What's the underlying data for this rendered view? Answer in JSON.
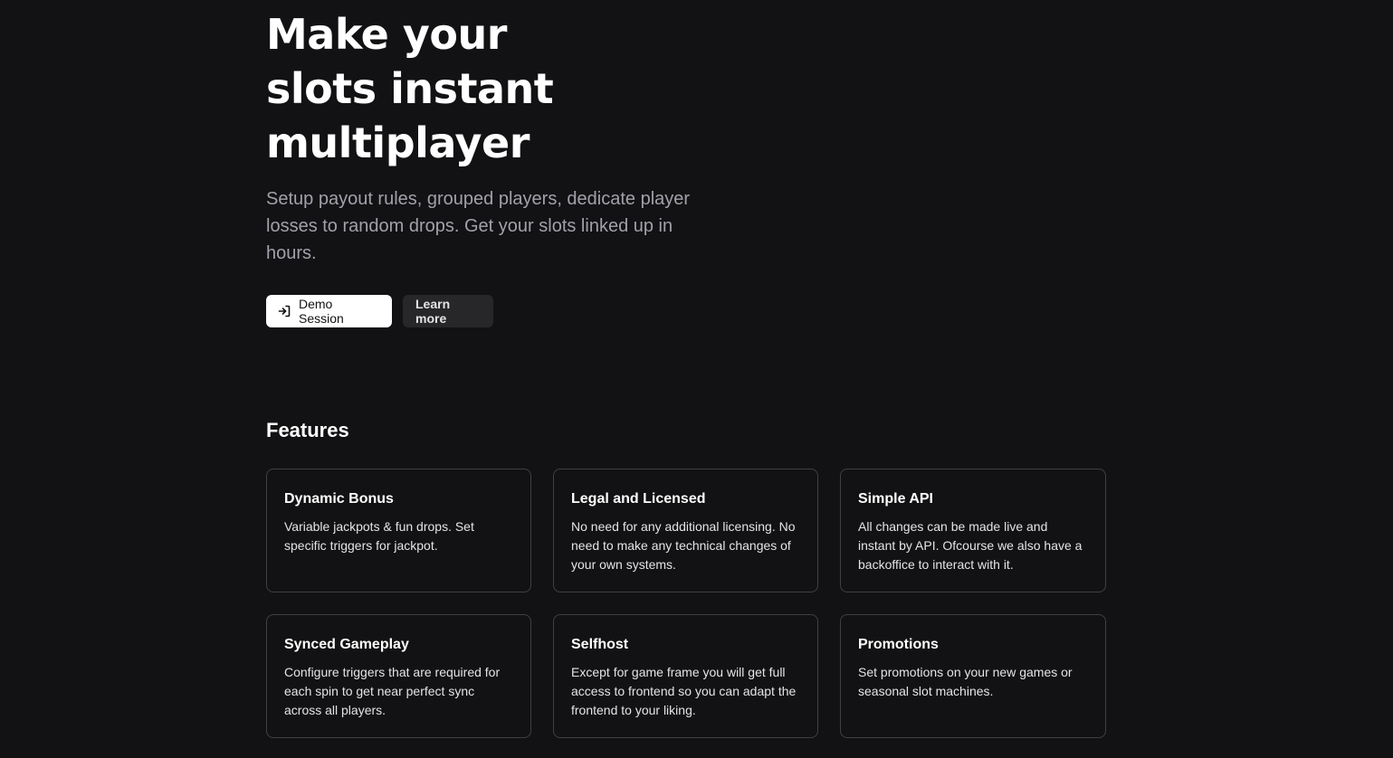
{
  "hero": {
    "title_lines": [
      "Make your",
      "slots instant",
      "multiplayer"
    ],
    "subtitle": "Setup payout rules, grouped players, dedicate player losses to random drops. Get your slots linked up in hours.",
    "primary_button": {
      "label": "Demo Session",
      "icon": "login-arrow-icon"
    },
    "secondary_button": {
      "label": "Learn more"
    }
  },
  "features": {
    "title": "Features",
    "items": [
      {
        "title": "Dynamic Bonus",
        "description": "Variable jackpots & fun drops. Set specific triggers for jackpot."
      },
      {
        "title": "Legal and Licensed",
        "description": "No need for any additional licensing. No need to make any technical changes of your own systems."
      },
      {
        "title": "Simple API",
        "description": "All changes can be made live and instant by API. Ofcourse we also have a backoffice to interact with it."
      },
      {
        "title": "Synced Gameplay",
        "description": "Configure triggers that are required for each spin to get near perfect sync across all players."
      },
      {
        "title": "Selfhost",
        "description": "Except for game frame you will get full access to frontend so you can adapt the frontend to your liking."
      },
      {
        "title": "Promotions",
        "description": "Set promotions on your new games or seasonal slot machines."
      }
    ]
  },
  "colors": {
    "background": "#121214",
    "text_primary": "#ffffff",
    "text_muted": "#a1a1aa",
    "card_border": "#3f3f46",
    "secondary_button_bg": "#27272a"
  }
}
